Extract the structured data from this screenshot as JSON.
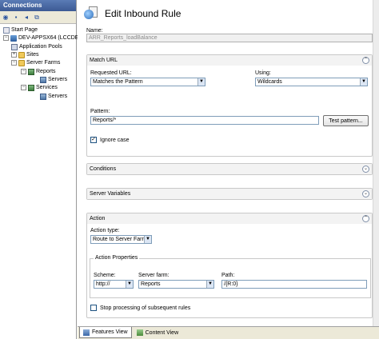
{
  "connections": {
    "title": "Connections",
    "tree": [
      {
        "label": "Start Page",
        "icon": "start-page-icon",
        "expander": ""
      },
      {
        "label": "DEV-APPSX64 (LCCDE",
        "icon": "server-icon",
        "expander": "−"
      },
      {
        "label": "Application Pools",
        "icon": "application-pools-icon",
        "expander": ""
      },
      {
        "label": "Sites",
        "icon": "sites-folder-icon",
        "expander": "+"
      },
      {
        "label": "Server Farms",
        "icon": "server-farms-icon",
        "expander": "−"
      },
      {
        "label": "Reports",
        "icon": "server-farm-icon",
        "expander": "−"
      },
      {
        "label": "Servers",
        "icon": "servers-icon",
        "expander": ""
      },
      {
        "label": "Services",
        "icon": "server-farm-icon",
        "expander": "−"
      },
      {
        "label": "Servers",
        "icon": "servers-icon",
        "expander": ""
      }
    ]
  },
  "header": {
    "title": "Edit Inbound Rule"
  },
  "rule": {
    "name_label": "Name:",
    "name_value": "ARR_Reports_loadBalance"
  },
  "match_url": {
    "title": "Match URL",
    "requested_url_label": "Requested URL:",
    "requested_url_value": "Matches the Pattern",
    "using_label": "Using:",
    "using_value": "Wildcards",
    "pattern_label": "Pattern:",
    "pattern_value": "Reports/*",
    "test_pattern_button": "Test pattern...",
    "ignore_case_label": "Ignore case",
    "ignore_case_checked": true
  },
  "conditions": {
    "title": "Conditions"
  },
  "server_variables": {
    "title": "Server Variables"
  },
  "action": {
    "title": "Action",
    "action_type_label": "Action type:",
    "action_type_value": "Route to Server Farm",
    "properties_title": "Action Properties",
    "scheme_label": "Scheme:",
    "scheme_value": "http://",
    "server_farm_label": "Server farm:",
    "server_farm_value": "Reports",
    "path_label": "Path:",
    "path_value": "/{R:0}",
    "stop_processing_label": "Stop processing of subsequent rules",
    "stop_processing_checked": false
  },
  "bottom_tabs": [
    {
      "label": "Features View",
      "icon": "features-view-icon",
      "active": true
    },
    {
      "label": "Content View",
      "icon": "content-view-icon",
      "active": false
    }
  ]
}
